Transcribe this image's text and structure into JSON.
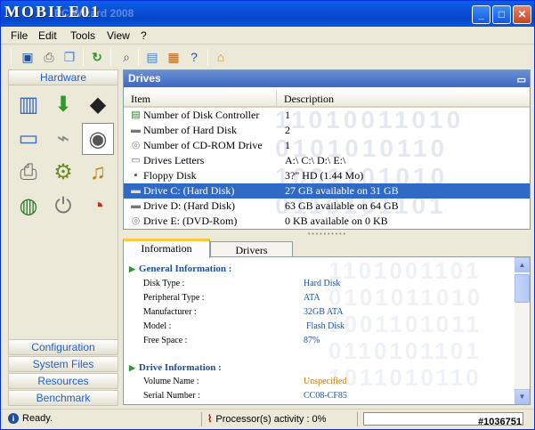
{
  "window": {
    "logo_text": "MOBILE01",
    "title": "PC Wizard 2008",
    "controls": {
      "minimize": "_",
      "maximize": "□",
      "close": "✕"
    }
  },
  "menu": [
    "File",
    "Edit",
    "Tools",
    "View",
    "?"
  ],
  "toolbar_icons": [
    "save-icon",
    "print-icon",
    "copy-icon",
    "refresh-icon",
    "find-icon",
    "report-icon",
    "export-icon",
    "help-icon",
    "home-icon"
  ],
  "left_panel": {
    "header": "Hardware",
    "icons": [
      "mainboard-icon",
      "download-icon",
      "chip-icon",
      "video-icon",
      "ports-icon",
      "drives-icon",
      "printer-icon",
      "devices-icon",
      "sound-icon",
      "network-icon",
      "power-icon",
      "voltage-icon"
    ],
    "selected_icon": "drives-icon",
    "buttons": [
      "Configuration",
      "System Files",
      "Resources",
      "Benchmark"
    ]
  },
  "drives": {
    "title": "Drives",
    "columns": [
      "Item",
      "Description"
    ],
    "rows": [
      {
        "item": "Number of Disk Controller",
        "desc": "1",
        "icon": "controller-icon"
      },
      {
        "item": "Number of Hard Disk",
        "desc": "2",
        "icon": "hdd-icon"
      },
      {
        "item": "Number of CD-ROM Drive",
        "desc": "1",
        "icon": "cdrom-icon"
      },
      {
        "item": "Drives Letters",
        "desc": "A:\\ C:\\ D:\\ E:\\",
        "icon": "drive-letters-icon"
      },
      {
        "item": "Floppy Disk",
        "desc": "3?\" HD (1.44 Mo)",
        "icon": "floppy-icon"
      },
      {
        "item": "Drive C: (Hard Disk)",
        "desc": "27 GB available on 31 GB",
        "icon": "hdd-icon"
      },
      {
        "item": "Drive D: (Hard Disk)",
        "desc": "63 GB available on 64 GB",
        "icon": "hdd-icon"
      },
      {
        "item": "Drive E: (DVD-Rom)",
        "desc": "0 KB available on 0 KB",
        "icon": "dvd-icon"
      }
    ],
    "selected_row": 5
  },
  "tabs": [
    "Information",
    "Drivers"
  ],
  "info": {
    "sections": [
      {
        "title": "General Information :",
        "fields": [
          {
            "k": "Disk Type :",
            "v": "Hard Disk"
          },
          {
            "k": "Peripheral Type :",
            "v": "ATA"
          },
          {
            "k": "Manufacturer :",
            "v": "32GB ATA"
          },
          {
            "k": "Model :",
            "v": "Flash Disk"
          },
          {
            "k": "Free Space :",
            "v": "87%"
          }
        ]
      },
      {
        "title": "Drive Information :",
        "fields": [
          {
            "k": "Volume Name :",
            "v": "Unspecified",
            "highlight": true
          },
          {
            "k": "Serial Number :",
            "v": "CC08-CF85"
          }
        ]
      }
    ]
  },
  "status": {
    "ready": "Ready.",
    "processor": "Processor(s) activity : 0%",
    "watermark": "#1036751"
  },
  "colors": {
    "titlebar": "#0A5FEB",
    "selection": "#316AC5",
    "panel_header": "#3D68C0",
    "link_blue": "#1E4E9C"
  }
}
